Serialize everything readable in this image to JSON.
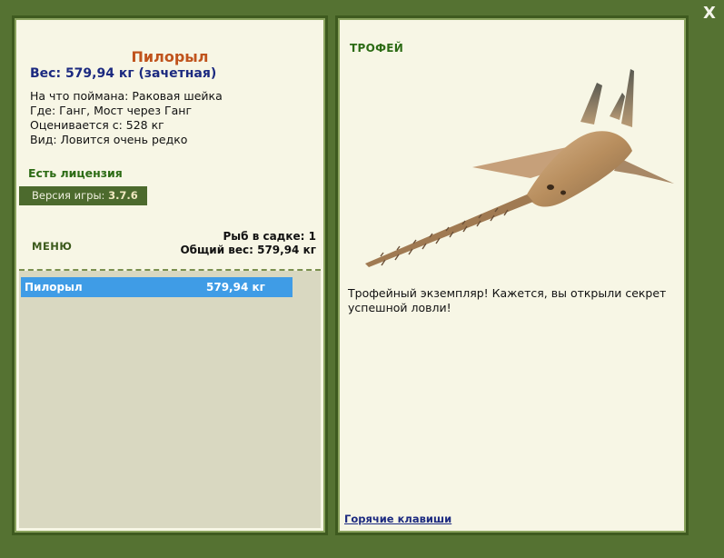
{
  "fish": {
    "name": "Пилорыл",
    "weight": "Вес: 579,94 кг (зачетная)",
    "caught_on": "На что поймана: Раковая шейка",
    "location": "Где: Ганг, Мост через Ганг",
    "value": "Оценивается с: 528 кг",
    "rarity": "Вид: Ловится очень редко"
  },
  "license": "Есть лицензия",
  "version": {
    "label": "Версия игры: ",
    "number": "3.7.6"
  },
  "menu_label": "МЕНЮ",
  "stats": {
    "count": "Рыб в садке: 1",
    "total_weight": "Общий вес: 579,94 кг"
  },
  "catch_list": [
    {
      "name": "Пилорыл",
      "weight": "579,94 кг"
    }
  ],
  "trophy": {
    "title": "ТРОФЕЙ",
    "image": "sawfish-image",
    "description": "Трофейный экземпляр! Кажется, вы открыли секрет успешной ловли!"
  },
  "hotkeys_link": "Горячие клавиши",
  "close_label": "X",
  "colors": {
    "background": "#557232",
    "panel": "#f7f6e5",
    "fish_name": "#c0531c",
    "weight": "#1c2a80",
    "selected_row": "#3f9ce6"
  }
}
